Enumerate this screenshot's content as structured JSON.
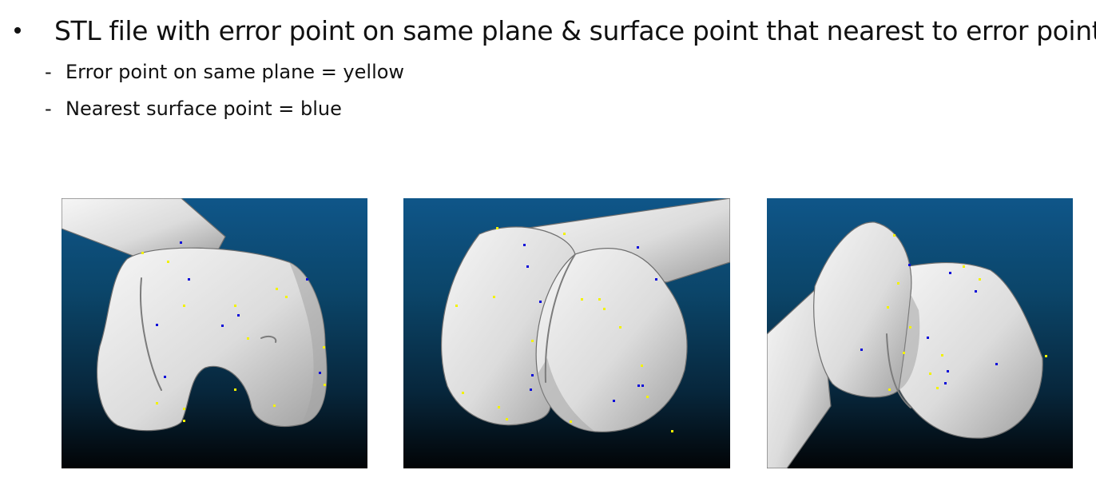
{
  "slide": {
    "title": "STL file with error point on same plane & surface point that nearest to error point",
    "legend": [
      {
        "dash": "-",
        "text": "Error point on same plane = yellow"
      },
      {
        "dash": "-",
        "text": "Nearest surface point = blue"
      }
    ]
  },
  "colors": {
    "error_point": "#f2f200",
    "nearest_point": "#0c0cd8",
    "background_top": "#0f5689",
    "background_bottom": "#020406"
  }
}
